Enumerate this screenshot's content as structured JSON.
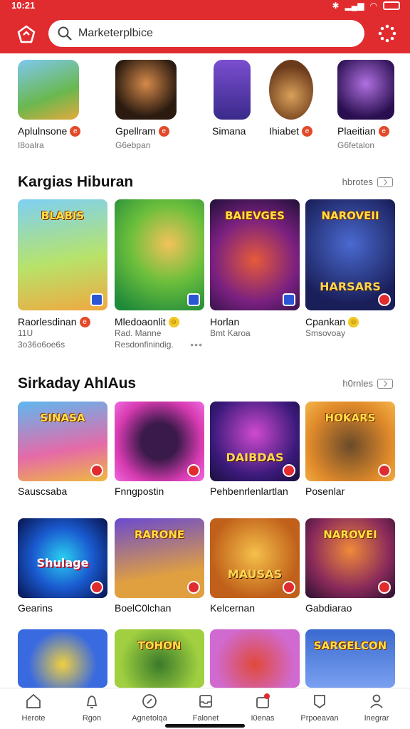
{
  "status": {
    "time": "10:21"
  },
  "search": {
    "placeholder": "Marketerplbice"
  },
  "top_apps": [
    {
      "name": "Aplulnsone",
      "sub": "I8oalra",
      "badge": "red"
    },
    {
      "name": "Gpellram",
      "sub": "G6ebpan",
      "badge": "red"
    },
    {
      "name": "Simana",
      "sub": "",
      "badge": ""
    },
    {
      "name": "Ihiabet",
      "sub": "",
      "badge": "red"
    },
    {
      "name": "Plaeitian",
      "sub": "G6fetalon",
      "badge": "red"
    }
  ],
  "section1": {
    "title": "Kargias Hiburan",
    "more": "hbrotes",
    "cards": [
      {
        "name": "Raorlesdinan",
        "sub1": "11U",
        "sub2": "3o36o6oe6s",
        "badge": "red",
        "banner": "BLABIS"
      },
      {
        "name": "Mledoaonlit",
        "sub1": "Rad. Manne",
        "sub2": "Resdonfinindig.",
        "badge": "yellow",
        "banner": ""
      },
      {
        "name": "Horlan",
        "sub1": "Bmt Karoa",
        "sub2": "",
        "badge": "",
        "banner": "BAIEVGES"
      },
      {
        "name": "Cpankan",
        "sub1": "Smsovoay",
        "sub2": "",
        "badge": "yellow",
        "banner": "NAROVEII",
        "banner2": "HARSARS"
      }
    ]
  },
  "section2": {
    "title": "Sirkaday AhlAus",
    "more": "h0rnles",
    "tiles": [
      {
        "name": "Sauscsaba",
        "banner": "SINASA"
      },
      {
        "name": "Fnngpostin",
        "banner": ""
      },
      {
        "name": "Pehbenrlenlartlan",
        "banner": "DAIBDAS"
      },
      {
        "name": "Posenlar",
        "banner": "HOKARS"
      },
      {
        "name": "Gearins",
        "banner": "Shulage"
      },
      {
        "name": "BoelC0lchan",
        "banner": "RARONE"
      },
      {
        "name": "Kelcernan",
        "banner": "MAUSAS"
      },
      {
        "name": "Gabdiarao",
        "banner": "NAROVEI"
      },
      {
        "name": "",
        "banner": ""
      },
      {
        "name": "",
        "banner": "TOHON"
      },
      {
        "name": "",
        "banner": ""
      },
      {
        "name": "",
        "banner": "SARGELCON"
      }
    ]
  },
  "nav": [
    {
      "label": "Herote",
      "icon": "home-icon"
    },
    {
      "label": "Rgon",
      "icon": "bell-icon"
    },
    {
      "label": "Agnetolqa",
      "icon": "compass-icon"
    },
    {
      "label": "Falonet",
      "icon": "inbox-icon"
    },
    {
      "label": "I0enas",
      "icon": "bag-icon"
    },
    {
      "label": "Prpoeavan",
      "icon": "bookmark-icon"
    },
    {
      "label": "Inegrar",
      "icon": "profile-icon"
    }
  ],
  "colors": {
    "brand": "#e02b2f",
    "badge_red": "#e24a2a",
    "badge_yellow": "#f3c623"
  }
}
